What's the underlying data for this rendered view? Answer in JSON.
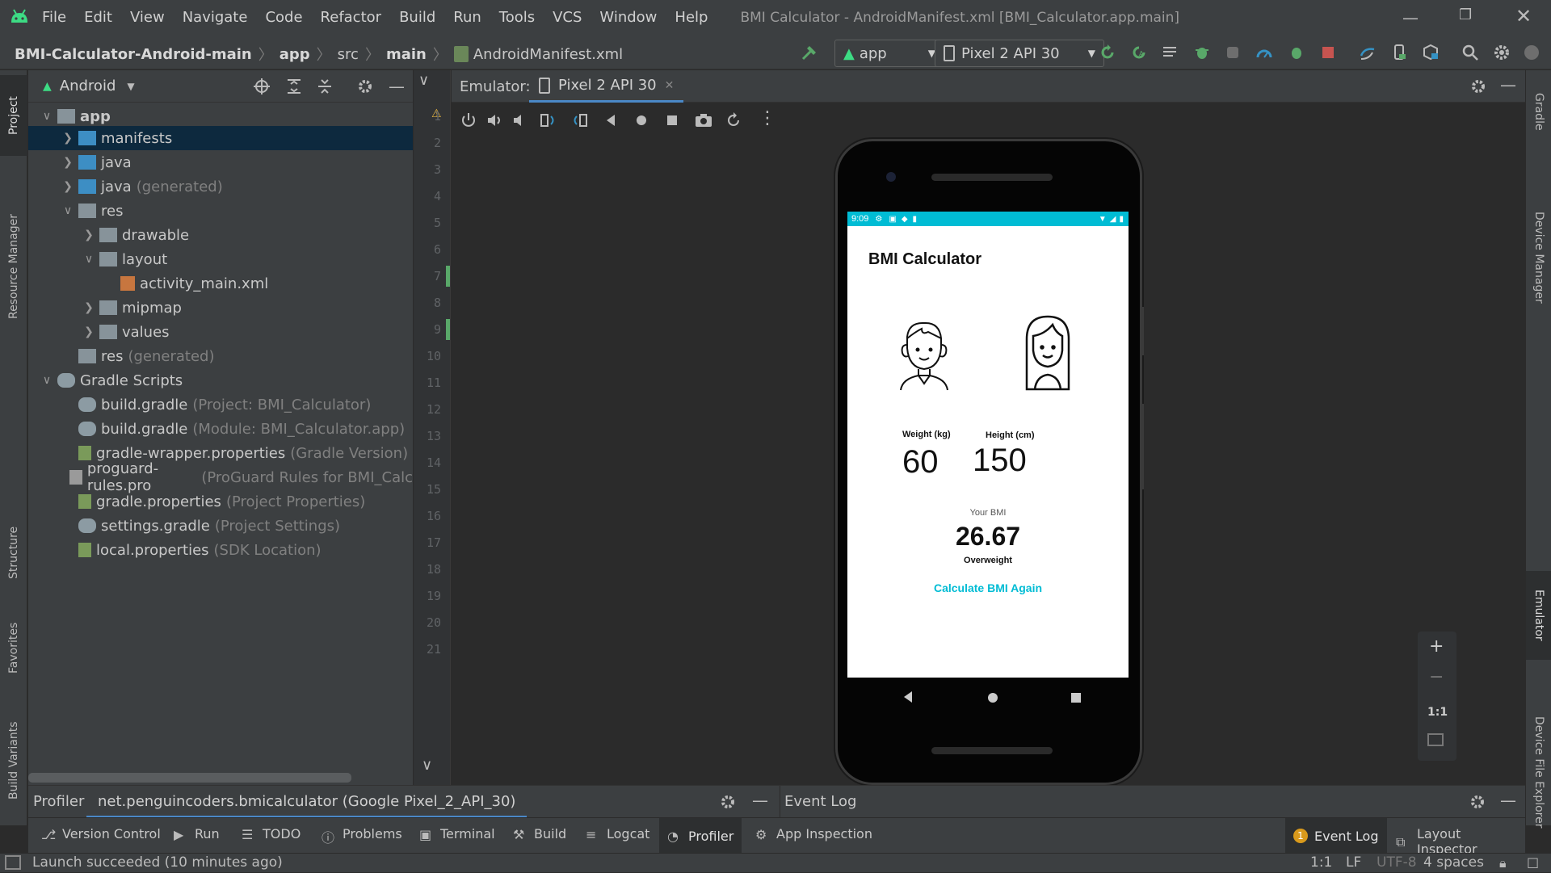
{
  "menubar": {
    "items": [
      "File",
      "Edit",
      "View",
      "Navigate",
      "Code",
      "Refactor",
      "Build",
      "Run",
      "Tools",
      "VCS",
      "Window",
      "Help"
    ],
    "window_title": "BMI Calculator - AndroidManifest.xml [BMI_Calculator.app.main]"
  },
  "breadcrumb": {
    "project": "BMI-Calculator-Android-main",
    "module": "app",
    "src": "src",
    "main": "main",
    "file": "AndroidManifest.xml"
  },
  "toolbar": {
    "config": "app",
    "device": "Pixel 2 API 30"
  },
  "left_stripe": [
    "Project",
    "Resource Manager",
    "Structure",
    "Favorites",
    "Build Variants"
  ],
  "right_stripe": [
    "Gradle",
    "Device Manager",
    "Emulator",
    "Device File Explorer"
  ],
  "project_panel": {
    "view": "Android",
    "tree": [
      {
        "label": "app",
        "hint": ""
      },
      {
        "label": "manifests",
        "hint": ""
      },
      {
        "label": "java",
        "hint": ""
      },
      {
        "label": "java",
        "hint": "(generated)"
      },
      {
        "label": "res",
        "hint": ""
      },
      {
        "label": "drawable",
        "hint": ""
      },
      {
        "label": "layout",
        "hint": ""
      },
      {
        "label": "activity_main.xml",
        "hint": ""
      },
      {
        "label": "mipmap",
        "hint": ""
      },
      {
        "label": "values",
        "hint": ""
      },
      {
        "label": "res",
        "hint": "(generated)"
      },
      {
        "label": "Gradle Scripts",
        "hint": ""
      },
      {
        "label": "build.gradle",
        "hint": "(Project: BMI_Calculator)"
      },
      {
        "label": "build.gradle",
        "hint": "(Module: BMI_Calculator.app)"
      },
      {
        "label": "gradle-wrapper.properties",
        "hint": "(Gradle Version)"
      },
      {
        "label": "proguard-rules.pro",
        "hint": "(ProGuard Rules for BMI_Calc"
      },
      {
        "label": "gradle.properties",
        "hint": "(Project Properties)"
      },
      {
        "label": "settings.gradle",
        "hint": "(Project Settings)"
      },
      {
        "label": "local.properties",
        "hint": "(SDK Location)"
      }
    ]
  },
  "gutter": {
    "lines": [
      "1",
      "2",
      "3",
      "4",
      "5",
      "6",
      "7",
      "8",
      "9",
      "10",
      "11",
      "12",
      "13",
      "14",
      "15",
      "16",
      "17",
      "18",
      "19",
      "20",
      "21"
    ]
  },
  "emulator": {
    "label": "Emulator:",
    "tab": "Pixel 2 API 30",
    "zoom_label": "1:1"
  },
  "app": {
    "status_time": "9:09",
    "title": "BMI Calculator",
    "weight_label": "Weight (kg)",
    "weight_value": "60",
    "height_label": "Height (cm)",
    "height_value": "150",
    "bmi_caption": "Your BMI",
    "bmi_value": "26.67",
    "bmi_category": "Overweight",
    "recalc": "Calculate BMI Again",
    "accent": "#00bcd4"
  },
  "bottom_panel": {
    "left_title": "Profiler",
    "session": "net.penguincoders.bmicalculator (Google Pixel_2_API_30)",
    "right_title": "Event Log"
  },
  "tool_windows": [
    "Version Control",
    "Run",
    "TODO",
    "Problems",
    "Terminal",
    "Build",
    "Logcat",
    "Profiler",
    "App Inspection"
  ],
  "tool_windows_right": {
    "event_log": "Event Log",
    "event_count": "1",
    "layout_inspector": "Layout Inspector"
  },
  "statusbar": {
    "message": "Launch succeeded (10 minutes ago)",
    "position": "1:1",
    "line_sep": "LF",
    "encoding": "UTF-8",
    "indent": "4 spaces"
  }
}
